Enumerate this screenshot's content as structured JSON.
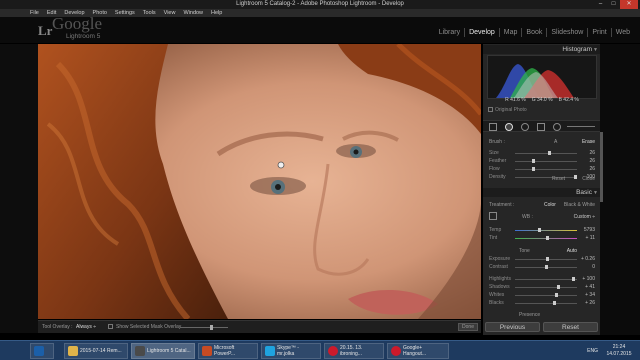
{
  "window": {
    "title": "Lightroom 5 Catalog-2 - Adobe Photoshop Lightroom - Develop",
    "controls": [
      "–",
      "□",
      "✕"
    ]
  },
  "menu": [
    "File",
    "Edit",
    "Develop",
    "Photo",
    "Settings",
    "Tools",
    "View",
    "Window",
    "Help"
  ],
  "header": {
    "logo": "Lr",
    "watermark": "Google",
    "app_name": "Lightroom 5",
    "modules": [
      {
        "label": "Library",
        "active": false
      },
      {
        "label": "Develop",
        "active": true
      },
      {
        "label": "Map",
        "active": false
      },
      {
        "label": "Book",
        "active": false
      },
      {
        "label": "Slideshow",
        "active": false
      },
      {
        "label": "Print",
        "active": false
      },
      {
        "label": "Web",
        "active": false
      }
    ]
  },
  "histogram": {
    "title": "Histogram",
    "readout": [
      "R",
      "41.6",
      "%",
      "G",
      "34.0",
      "%",
      "B",
      "42.4",
      "%"
    ],
    "original_photo_label": "Original Photo"
  },
  "brush": {
    "label": "Brush :",
    "a_label": "A",
    "b_label": "B",
    "erase_label": "Erase",
    "sliders": [
      {
        "label": "Size",
        "value": "26",
        "pos": 0.55
      },
      {
        "label": "Feather",
        "value": "26",
        "pos": 0.3
      },
      {
        "label": "Flow",
        "value": "26",
        "pos": 0.3
      },
      {
        "label": "Density",
        "value": "100",
        "pos": 0.98
      }
    ],
    "reset_label": "Reset",
    "close_label": "Close"
  },
  "basic": {
    "title": "Basic",
    "treatment_label": "Treatment :",
    "color_label": "Color",
    "bw_label": "Black & White",
    "wb_label": "WB :",
    "wb_value": "Custom ÷",
    "temp": {
      "label": "Temp",
      "value": "5793",
      "pos": 0.4
    },
    "tint": {
      "label": "Tint",
      "value": "+ 11",
      "pos": 0.52
    },
    "tone_label": "Tone",
    "auto_label": "Auto",
    "tone_sliders": [
      {
        "label": "Exposure",
        "value": "+ 0.26",
        "pos": 0.52
      },
      {
        "label": "Contrast",
        "value": "0",
        "pos": 0.5
      }
    ],
    "presence_sliders": [
      {
        "label": "Highlights",
        "value": "+ 100",
        "pos": 0.95
      },
      {
        "label": "Shadows",
        "value": "+ 41",
        "pos": 0.7
      },
      {
        "label": "Whites",
        "value": "+ 34",
        "pos": 0.67
      },
      {
        "label": "Blacks",
        "value": "+ 26",
        "pos": 0.63
      }
    ],
    "presence_label": "Presence"
  },
  "toolbar": {
    "overlay_label": "Tool Overlay :",
    "overlay_value": "Always ÷",
    "show_mask_label": "Show Selected Mask Overlay",
    "done_label": "Done"
  },
  "bottom_buttons": {
    "previous": "Previous",
    "reset": "Reset"
  },
  "taskbar": {
    "items": [
      {
        "label": "",
        "icon": "photoshop-icon",
        "color": "#1b5fa8"
      },
      {
        "label": "2015-07-14 Rem...",
        "icon": "folder-icon",
        "color": "#e0b44a"
      },
      {
        "label": "Lightroom 5 Catal...",
        "icon": "lightroom-icon",
        "color": "#4a4a4a"
      },
      {
        "label": "Microsoft PowerP...",
        "icon": "powerpoint-icon",
        "color": "#c64b24"
      },
      {
        "label": "Skype™ - mr.jolka",
        "icon": "skype-icon",
        "color": "#1fa3df"
      },
      {
        "label": "20.15. 13. ibroning...",
        "icon": "opera-icon",
        "color": "#cc1a2b"
      },
      {
        "label": "Google+ Hangout...",
        "icon": "opera-icon",
        "color": "#cc1a2b"
      }
    ],
    "lang": "ENG",
    "time": "21:24",
    "date": "14.07.2015"
  },
  "colors": {
    "panel": "#262626",
    "header": "#0b0b0b",
    "taskbar": "#1e3a5f",
    "close_btn": "#c4372b"
  }
}
